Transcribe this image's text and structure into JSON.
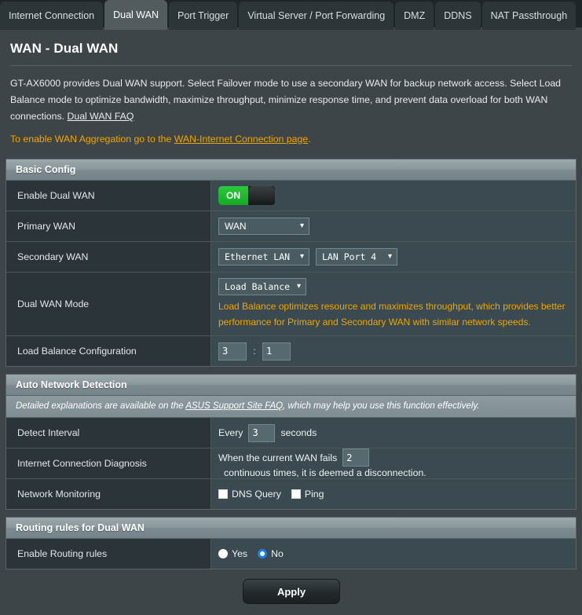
{
  "tabs": [
    {
      "label": "Internet Connection",
      "active": false
    },
    {
      "label": "Dual WAN",
      "active": true
    },
    {
      "label": "Port Trigger",
      "active": false
    },
    {
      "label": "Virtual Server / Port Forwarding",
      "active": false
    },
    {
      "label": "DMZ",
      "active": false
    },
    {
      "label": "DDNS",
      "active": false
    },
    {
      "label": "NAT Passthrough",
      "active": false
    }
  ],
  "header": {
    "title": "WAN - Dual WAN",
    "description_part1": "GT-AX6000 provides Dual WAN support. Select Failover mode to use a secondary WAN for backup network access. Select Load Balance mode to optimize bandwidth, maximize throughput, minimize response time, and prevent data overload for both WAN connections. ",
    "description_link": "Dual WAN FAQ",
    "note_prefix": "To enable WAN Aggregation go to the ",
    "note_link": "WAN-Internet Connection page",
    "note_suffix": "."
  },
  "basic_config": {
    "title": "Basic Config",
    "enable_dual_wan": {
      "label": "Enable Dual WAN",
      "state": "ON"
    },
    "primary_wan": {
      "label": "Primary WAN",
      "value": "WAN",
      "caret": "chevron-down-icon"
    },
    "secondary_wan": {
      "label": "Secondary WAN",
      "value": "Ethernet LAN",
      "port_value": "LAN Port 4"
    },
    "dual_wan_mode": {
      "label": "Dual WAN Mode",
      "value": "Load Balance",
      "hint": "Load Balance optimizes resource and maximizes throughput, which provides better performance for Primary and Secondary WAN with similar network speeds."
    },
    "load_balance_config": {
      "label": "Load Balance Configuration",
      "primary_weight": "3",
      "separator": ":",
      "secondary_weight": "1"
    }
  },
  "auto_network_detection": {
    "title": "Auto Network Detection",
    "subtitle_prefix": "Detailed explanations are available on the  ",
    "subtitle_link": "ASUS Support Site FAQ",
    "subtitle_suffix": ", which may help you use this function effectively.",
    "detect_interval": {
      "label": "Detect Interval",
      "prefix": "Every",
      "value": "3",
      "suffix": "seconds"
    },
    "internet_connection_diagnosis": {
      "label": "Internet Connection Diagnosis",
      "prefix": "When the current WAN fails",
      "value": "2",
      "suffix": "continuous times, it is deemed a disconnection."
    },
    "network_monitoring": {
      "label": "Network Monitoring",
      "options": [
        {
          "label": "DNS Query",
          "checked": false
        },
        {
          "label": "Ping",
          "checked": false
        }
      ]
    }
  },
  "routing_rules": {
    "title": "Routing rules for Dual WAN",
    "enable_routing_rules": {
      "label": "Enable Routing rules",
      "options": [
        {
          "label": "Yes",
          "selected": false
        },
        {
          "label": "No",
          "selected": true
        }
      ]
    }
  },
  "footer": {
    "apply_label": "Apply"
  },
  "colors": {
    "accent_orange": "#f0a500",
    "toggle_green": "#1fba2e",
    "radio_blue": "#1d7de8",
    "page_bg": "#3d4548",
    "label_col_bg": "#2b3438",
    "value_col_bg": "#3a4a50"
  }
}
